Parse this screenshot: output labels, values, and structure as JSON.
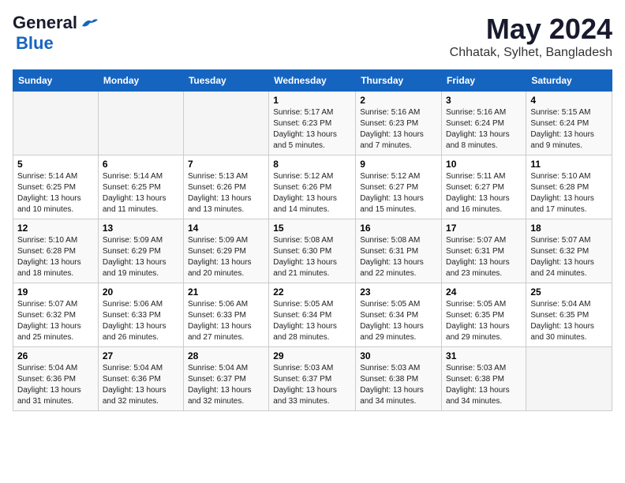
{
  "logo": {
    "line1": "General",
    "line2": "Blue"
  },
  "title": "May 2024",
  "subtitle": "Chhatak, Sylhet, Bangladesh",
  "days_header": [
    "Sunday",
    "Monday",
    "Tuesday",
    "Wednesday",
    "Thursday",
    "Friday",
    "Saturday"
  ],
  "weeks": [
    [
      {
        "day": "",
        "info": ""
      },
      {
        "day": "",
        "info": ""
      },
      {
        "day": "",
        "info": ""
      },
      {
        "day": "1",
        "info": "Sunrise: 5:17 AM\nSunset: 6:23 PM\nDaylight: 13 hours\nand 5 minutes."
      },
      {
        "day": "2",
        "info": "Sunrise: 5:16 AM\nSunset: 6:23 PM\nDaylight: 13 hours\nand 7 minutes."
      },
      {
        "day": "3",
        "info": "Sunrise: 5:16 AM\nSunset: 6:24 PM\nDaylight: 13 hours\nand 8 minutes."
      },
      {
        "day": "4",
        "info": "Sunrise: 5:15 AM\nSunset: 6:24 PM\nDaylight: 13 hours\nand 9 minutes."
      }
    ],
    [
      {
        "day": "5",
        "info": "Sunrise: 5:14 AM\nSunset: 6:25 PM\nDaylight: 13 hours\nand 10 minutes."
      },
      {
        "day": "6",
        "info": "Sunrise: 5:14 AM\nSunset: 6:25 PM\nDaylight: 13 hours\nand 11 minutes."
      },
      {
        "day": "7",
        "info": "Sunrise: 5:13 AM\nSunset: 6:26 PM\nDaylight: 13 hours\nand 13 minutes."
      },
      {
        "day": "8",
        "info": "Sunrise: 5:12 AM\nSunset: 6:26 PM\nDaylight: 13 hours\nand 14 minutes."
      },
      {
        "day": "9",
        "info": "Sunrise: 5:12 AM\nSunset: 6:27 PM\nDaylight: 13 hours\nand 15 minutes."
      },
      {
        "day": "10",
        "info": "Sunrise: 5:11 AM\nSunset: 6:27 PM\nDaylight: 13 hours\nand 16 minutes."
      },
      {
        "day": "11",
        "info": "Sunrise: 5:10 AM\nSunset: 6:28 PM\nDaylight: 13 hours\nand 17 minutes."
      }
    ],
    [
      {
        "day": "12",
        "info": "Sunrise: 5:10 AM\nSunset: 6:28 PM\nDaylight: 13 hours\nand 18 minutes."
      },
      {
        "day": "13",
        "info": "Sunrise: 5:09 AM\nSunset: 6:29 PM\nDaylight: 13 hours\nand 19 minutes."
      },
      {
        "day": "14",
        "info": "Sunrise: 5:09 AM\nSunset: 6:29 PM\nDaylight: 13 hours\nand 20 minutes."
      },
      {
        "day": "15",
        "info": "Sunrise: 5:08 AM\nSunset: 6:30 PM\nDaylight: 13 hours\nand 21 minutes."
      },
      {
        "day": "16",
        "info": "Sunrise: 5:08 AM\nSunset: 6:31 PM\nDaylight: 13 hours\nand 22 minutes."
      },
      {
        "day": "17",
        "info": "Sunrise: 5:07 AM\nSunset: 6:31 PM\nDaylight: 13 hours\nand 23 minutes."
      },
      {
        "day": "18",
        "info": "Sunrise: 5:07 AM\nSunset: 6:32 PM\nDaylight: 13 hours\nand 24 minutes."
      }
    ],
    [
      {
        "day": "19",
        "info": "Sunrise: 5:07 AM\nSunset: 6:32 PM\nDaylight: 13 hours\nand 25 minutes."
      },
      {
        "day": "20",
        "info": "Sunrise: 5:06 AM\nSunset: 6:33 PM\nDaylight: 13 hours\nand 26 minutes."
      },
      {
        "day": "21",
        "info": "Sunrise: 5:06 AM\nSunset: 6:33 PM\nDaylight: 13 hours\nand 27 minutes."
      },
      {
        "day": "22",
        "info": "Sunrise: 5:05 AM\nSunset: 6:34 PM\nDaylight: 13 hours\nand 28 minutes."
      },
      {
        "day": "23",
        "info": "Sunrise: 5:05 AM\nSunset: 6:34 PM\nDaylight: 13 hours\nand 29 minutes."
      },
      {
        "day": "24",
        "info": "Sunrise: 5:05 AM\nSunset: 6:35 PM\nDaylight: 13 hours\nand 29 minutes."
      },
      {
        "day": "25",
        "info": "Sunrise: 5:04 AM\nSunset: 6:35 PM\nDaylight: 13 hours\nand 30 minutes."
      }
    ],
    [
      {
        "day": "26",
        "info": "Sunrise: 5:04 AM\nSunset: 6:36 PM\nDaylight: 13 hours\nand 31 minutes."
      },
      {
        "day": "27",
        "info": "Sunrise: 5:04 AM\nSunset: 6:36 PM\nDaylight: 13 hours\nand 32 minutes."
      },
      {
        "day": "28",
        "info": "Sunrise: 5:04 AM\nSunset: 6:37 PM\nDaylight: 13 hours\nand 32 minutes."
      },
      {
        "day": "29",
        "info": "Sunrise: 5:03 AM\nSunset: 6:37 PM\nDaylight: 13 hours\nand 33 minutes."
      },
      {
        "day": "30",
        "info": "Sunrise: 5:03 AM\nSunset: 6:38 PM\nDaylight: 13 hours\nand 34 minutes."
      },
      {
        "day": "31",
        "info": "Sunrise: 5:03 AM\nSunset: 6:38 PM\nDaylight: 13 hours\nand 34 minutes."
      },
      {
        "day": "",
        "info": ""
      }
    ]
  ]
}
